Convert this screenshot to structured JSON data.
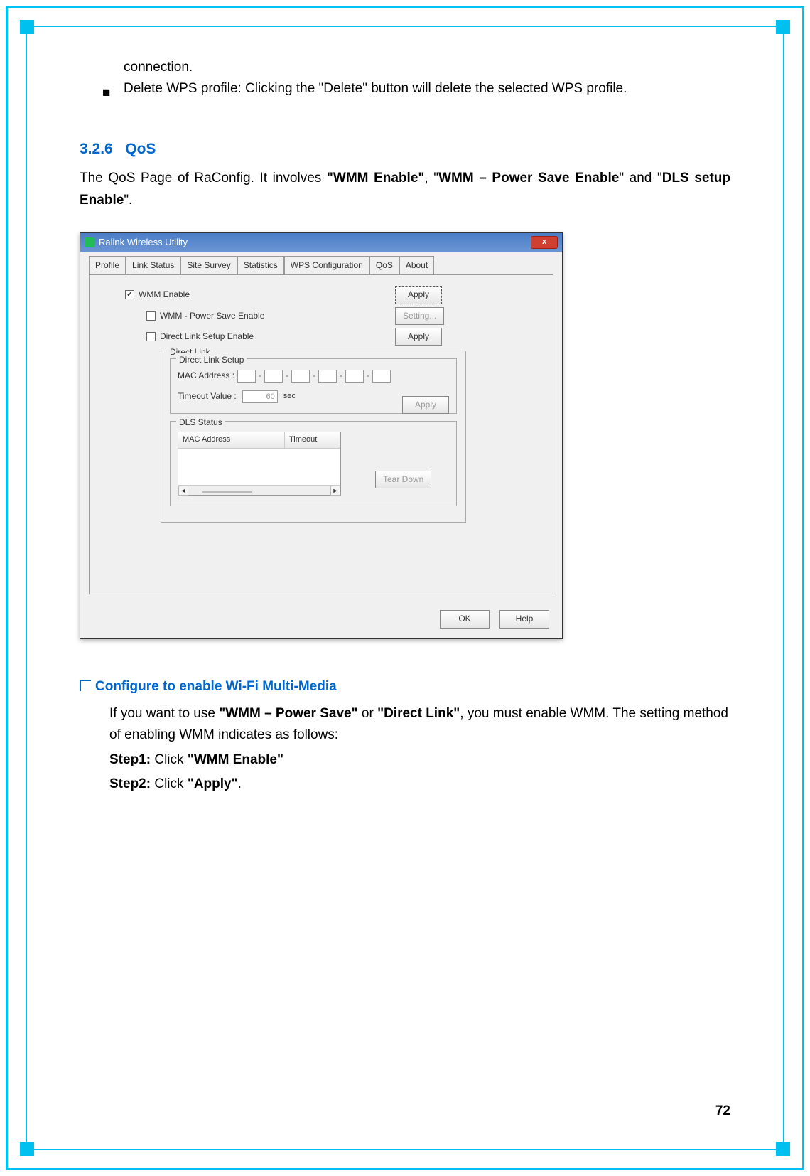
{
  "intro": {
    "line1": "connection.",
    "bullet_label": "■",
    "bullet_text": "Delete WPS profile: Clicking the \"Delete\" button will delete the selected WPS profile."
  },
  "section": {
    "number": "3.2.6",
    "title": "QoS",
    "para_pre": "The QoS Page of RaConfig. It involves ",
    "bold1": "\"WMM Enable\"",
    "mid1": ", \"",
    "bold2": "WMM – Power Save Enable",
    "mid2": "\" and \"",
    "bold3": "DLS setup Enable",
    "tail": "\"."
  },
  "win": {
    "title": "Ralink Wireless Utility",
    "close": "x",
    "tabs": [
      "Profile",
      "Link Status",
      "Site Survey",
      "Statistics",
      "WPS Configuration",
      "QoS",
      "About"
    ],
    "cb_wmm": "WMM Enable",
    "cb_ps": "WMM - Power Save Enable",
    "cb_dls": "Direct Link Setup Enable",
    "btn_apply": "Apply",
    "btn_setting": "Setting...",
    "fs_dl": "Direct Link",
    "fs_setup": "Direct Link Setup",
    "mac_label": "MAC Address :",
    "timeout_label": "Timeout Value :",
    "timeout_val": "60",
    "timeout_unit": "sec",
    "fs_status": "DLS Status",
    "col_mac": "MAC Address",
    "col_timeout": "Timeout",
    "btn_teardown": "Tear Down",
    "btn_ok": "OK",
    "btn_help": "Help",
    "sb_left": "◄",
    "sb_right": "►"
  },
  "sub": {
    "heading": "Configure to enable Wi-Fi Multi-Media",
    "p1_a": "If you want to use ",
    "p1_b1": "\"WMM – Power Save\"",
    "p1_m": " or ",
    "p1_b2": "\"Direct Link\"",
    "p1_c": ", you must enable WMM. The setting method of enabling WMM indicates as follows:",
    "s1_a": "Step1:",
    "s1_b": " Click ",
    "s1_c": "\"WMM Enable\"",
    "s2_a": "Step2:",
    "s2_b": " Click ",
    "s2_c": "\"Apply\"",
    "s2_d": "."
  },
  "page_number": "72"
}
